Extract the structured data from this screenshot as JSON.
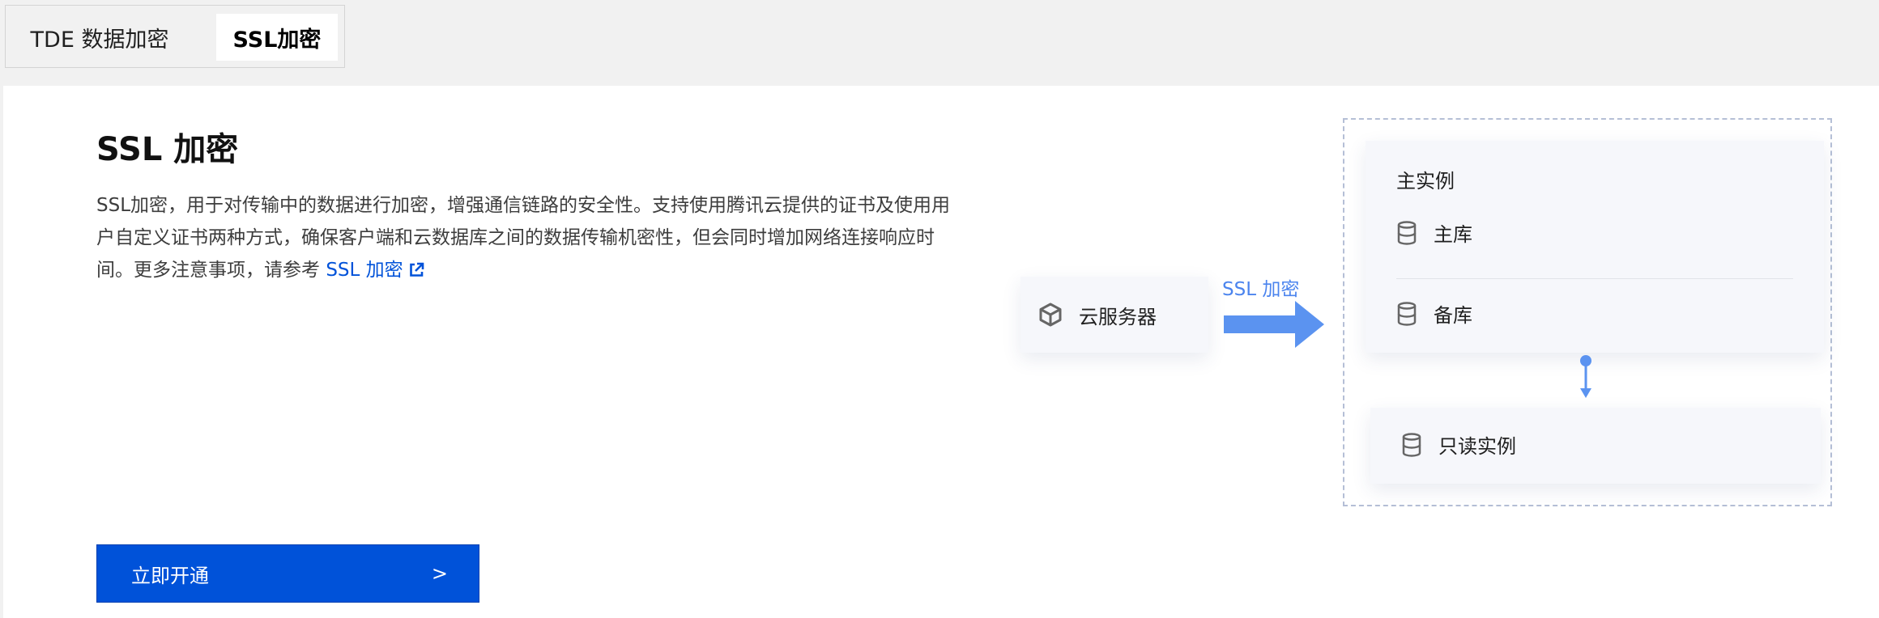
{
  "tabs": [
    {
      "label": "TDE 数据加密",
      "active": false
    },
    {
      "label": "SSL加密",
      "active": true
    }
  ],
  "main": {
    "title": "SSL 加密",
    "description": "SSL加密，用于对传输中的数据进行加密，增强通信链路的安全性。支持使用腾讯云提供的证书及使用用户自定义证书两种方式，确保客户端和云数据库之间的数据传输机密性，但会同时增加网络连接响应时间。更多注意事项，请参考",
    "doc_link_label": "SSL 加密",
    "doc_link_icon": "external-link-icon",
    "enable_button_label": "立即开通",
    "enable_button_arrow": ">"
  },
  "diagram": {
    "server_label": "云服务器",
    "server_icon": "cube-icon",
    "ssl_label": "SSL 加密",
    "primary_instance_title": "主实例",
    "primary_db_label": "主库",
    "backup_db_label": "备库",
    "readonly_instance_label": "只读实例",
    "db_icon": "database-icon"
  },
  "colors": {
    "accent": "#0052d9",
    "arrow": "#5b93f0",
    "tab_bg": "#f1f1f1",
    "card_bg": "#f6f7fb"
  }
}
